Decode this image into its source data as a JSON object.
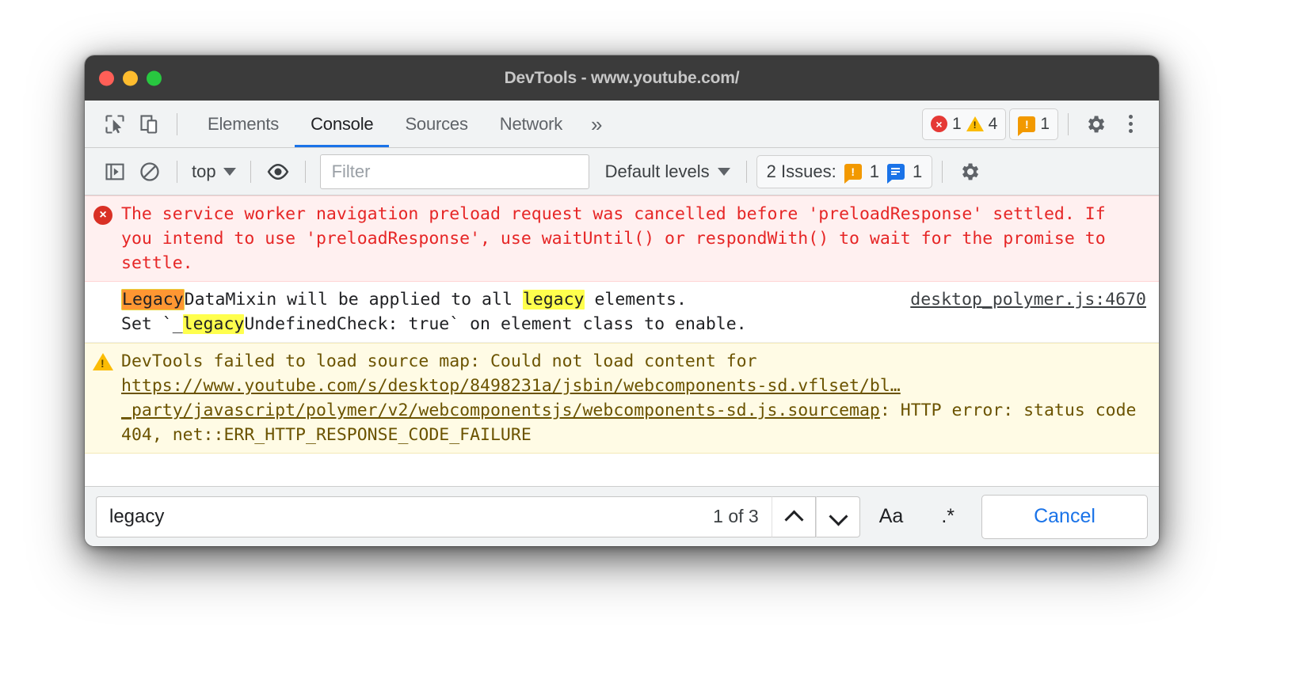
{
  "window": {
    "title": "DevTools - www.youtube.com/",
    "traffic_lights": [
      "close",
      "minimize",
      "maximize"
    ]
  },
  "tabstrip": {
    "inspect_icon": "inspect-cursor-icon",
    "device_icon": "device-toolbar-icon",
    "tabs": [
      {
        "label": "Elements",
        "active": false
      },
      {
        "label": "Console",
        "active": true
      },
      {
        "label": "Sources",
        "active": false
      },
      {
        "label": "Network",
        "active": false
      }
    ],
    "more_tabs": "»",
    "error_count": "1",
    "warning_count": "4",
    "issue_count": "1",
    "settings_icon": "gear-icon",
    "menu_icon": "kebab-menu-icon"
  },
  "console_toolbar": {
    "sidebar_icon": "console-sidebar-icon",
    "clear_icon": "clear-console-icon",
    "context": "top",
    "eye_icon": "live-expression-eye-icon",
    "filter_placeholder": "Filter",
    "filter_value": "",
    "levels": "Default levels",
    "issues_label": "2 Issues:",
    "issues_warning_count": "1",
    "issues_info_count": "1",
    "settings_icon": "console-settings-gear-icon"
  },
  "console_messages": [
    {
      "type": "error",
      "icon": "error-circle-icon",
      "text": "The service worker navigation preload request was cancelled before 'preloadResponse' settled. If you intend to use 'preloadResponse', use waitUntil() or respondWith() to wait for the promise to settle."
    },
    {
      "type": "info",
      "icon": "none",
      "segments": [
        {
          "text": "Legacy",
          "highlight": "current"
        },
        {
          "text": "DataMixin will be applied to all ",
          "highlight": "none"
        },
        {
          "text": "legacy",
          "highlight": "match"
        },
        {
          "text": " elements.\nSet `_",
          "highlight": "none"
        },
        {
          "text": "legacy",
          "highlight": "match"
        },
        {
          "text": "UndefinedCheck: true` on element class to enable.",
          "highlight": "none"
        }
      ],
      "source_link": "desktop_polymer.js:4670"
    },
    {
      "type": "warning",
      "icon": "warning-triangle-icon",
      "segments": [
        {
          "text": "DevTools failed to load source map: Could not load content for ",
          "link": false
        },
        {
          "text": "https://www.youtube.com/s/desktop/8498231a/jsbin/webcomponents-sd.vflset/bl…_party/javascript/polymer/v2/webcomponentsjs/webcomponents-sd.js.sourcemap",
          "link": true
        },
        {
          "text": ": HTTP error: status code 404, net::ERR_HTTP_RESPONSE_CODE_FAILURE",
          "link": false
        }
      ]
    }
  ],
  "search_bar": {
    "query": "legacy",
    "match_count": "1 of 3",
    "prev_icon": "chevron-up-icon",
    "next_icon": "chevron-down-icon",
    "match_case_label": "Aa",
    "regex_label": ".*",
    "cancel_label": "Cancel"
  },
  "colors": {
    "accent": "#1a73e8",
    "error": "#e62626",
    "warning_bg": "#fffbe5",
    "error_bg": "#fff0f0",
    "current_match": "#ff9632",
    "match": "#ffff4d"
  }
}
